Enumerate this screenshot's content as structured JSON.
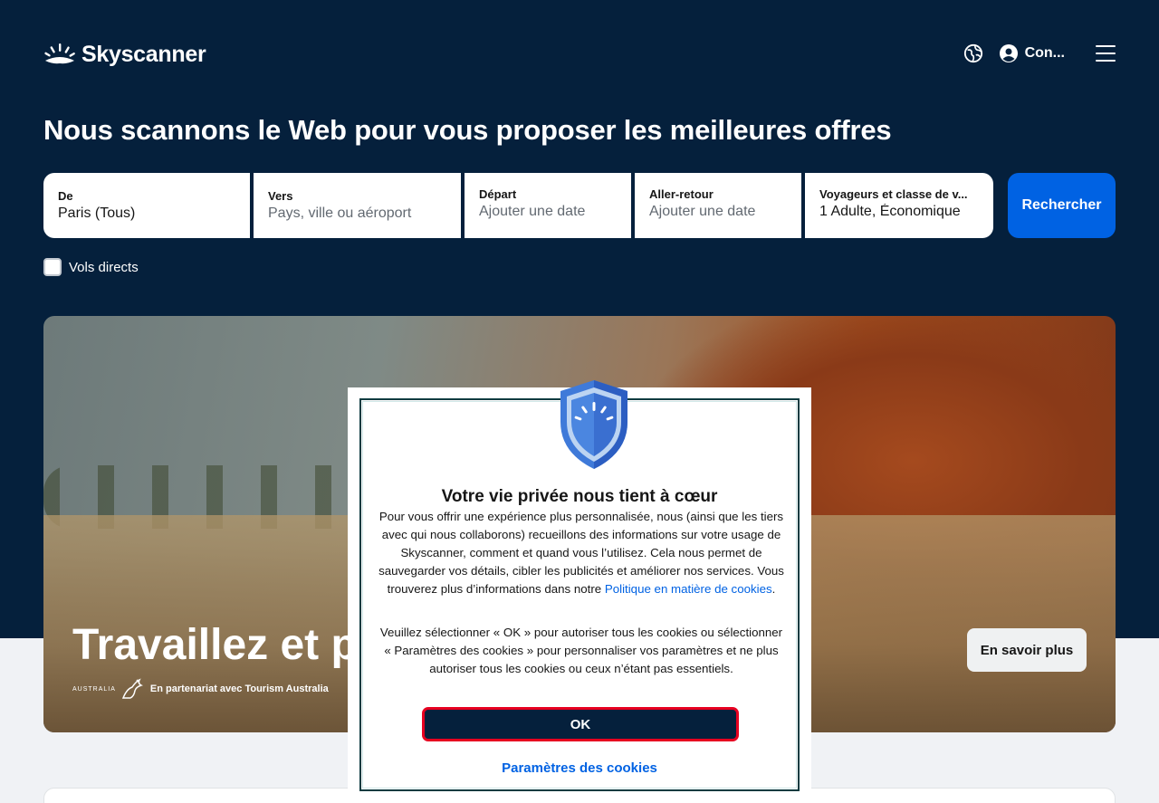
{
  "header": {
    "brand": "Skyscanner",
    "account_label": "Con...",
    "icons": [
      "sunrise-logo-icon",
      "globe-icon",
      "account-icon",
      "menu-icon"
    ]
  },
  "headline": "Nous scannons le Web pour vous proposer les meilleures offres",
  "search": {
    "from": {
      "label": "De",
      "value": "Paris (Tous)"
    },
    "to": {
      "label": "Vers",
      "placeholder": "Pays, ville ou aéroport"
    },
    "depart": {
      "label": "Départ",
      "placeholder": "Ajouter une date"
    },
    "return": {
      "label": "Aller-retour",
      "placeholder": "Ajouter une date"
    },
    "travellers": {
      "label": "Voyageurs et classe de v...",
      "value": "1 Adulte, Économique"
    },
    "submit_label": "Rechercher",
    "direct_label": "Vols directs"
  },
  "hero": {
    "title": "Travaillez et pr",
    "partner_brand": "AUSTRALIA",
    "partner_text": "En partenariat avec Tourism Australia",
    "cta_label": "En savoir plus"
  },
  "cookie_modal": {
    "title": "Votre vie privée nous tient à cœur",
    "paragraph1": "Pour vous offrir une expérience plus personnalisée, nous (ainsi que les tiers avec qui nous collaborons) recueillons des informations sur votre usage de Skyscanner, comment et quand vous l’utilisez. Cela nous permet de sauvegarder vos détails, cibler les publicités et améliorer nos services. Vous trouverez plus d’informations dans notre ",
    "policy_link": "Politique en matière de cookies",
    "paragraph1_end": ".",
    "paragraph2": "Veuillez sélectionner « OK » pour autoriser tous les cookies ou sélectionner « Paramètres des cookies » pour personnaliser vos paramètres et ne plus autoriser tous les cookies ou ceux n’étant pas essentiels.",
    "ok_label": "OK",
    "settings_label": "Paramètres des cookies"
  },
  "colors": {
    "navy": "#05203c",
    "primary_blue": "#0062e3",
    "highlight_red": "#e70020"
  }
}
